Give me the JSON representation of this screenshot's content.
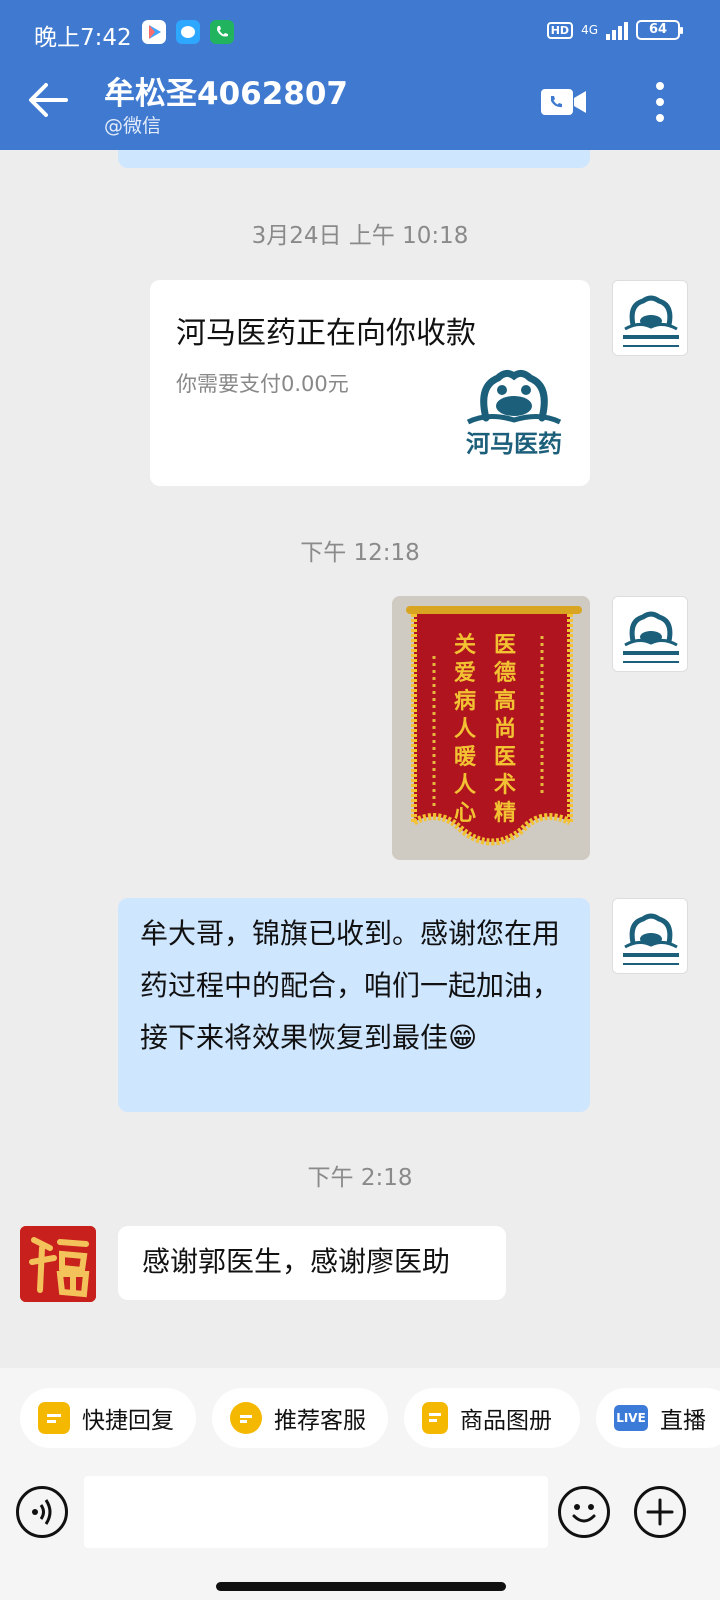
{
  "status_bar": {
    "time": "晚上7:42",
    "hd": "HD",
    "network": "4G",
    "battery": "64"
  },
  "header": {
    "title": "牟松圣4062807",
    "subtitle": "@微信"
  },
  "messages": {
    "time1": "3月24日  上午 10:18",
    "payment_title": "河马医药正在向你收款",
    "payment_sub": "你需要支付0.00元",
    "payment_logo_text": "河马医药",
    "time2": "下午 12:18",
    "banner_lines": [
      "医德高尚医术精",
      "关爱病人暖人心"
    ],
    "agent_text": "牟大哥，锦旗已收到。感谢您在用药过程中的配合，咱们一起加油，接下来将效果恢复到最佳😁",
    "time3": "下午 2:18",
    "customer_text": "感谢郭医生，感谢廖医助"
  },
  "quick_replies": [
    {
      "label": "快捷回复",
      "icon": "quick-reply-icon",
      "color": "#f5b800"
    },
    {
      "label": "推荐客服",
      "icon": "recommend-service-icon",
      "color": "#f5b800"
    },
    {
      "label": "商品图册",
      "icon": "product-album-icon",
      "color": "#f5b800"
    },
    {
      "label": "直播",
      "icon": "live-icon",
      "color": "#3d7bd9"
    }
  ],
  "icons": {
    "back": "back-arrow-icon",
    "video": "video-call-icon",
    "more": "more-vertical-icon",
    "voice": "voice-icon",
    "emoji": "emoji-icon",
    "plus": "plus-icon"
  },
  "colors": {
    "header": "#3f7ad0",
    "bubble_sent": "#cfe6ff",
    "bubble_received": "#ffffff",
    "background": "#ededed"
  }
}
